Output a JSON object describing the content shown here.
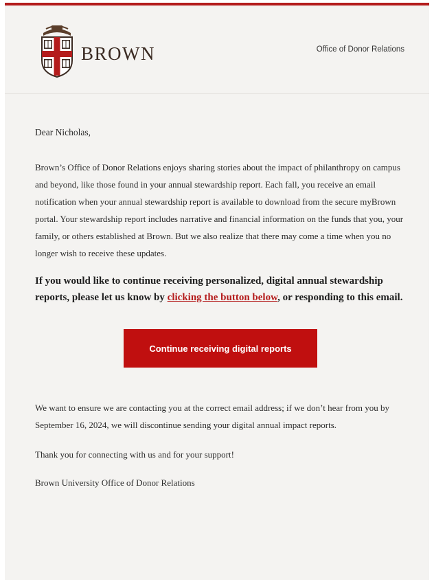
{
  "header": {
    "brand_name": "BROWN",
    "office_label": "Office of Donor Relations",
    "logo_icon": "brown-university-shield-icon",
    "accent_color": "#b41c1c"
  },
  "email": {
    "greeting": "Dear Nicholas,",
    "paragraph_1": "Brown’s Office of Donor Relations enjoys sharing stories about the impact of philanthropy on campus and beyond, like those found in your annual stewardship report. Each fall, you receive an email notification when your annual stewardship report is available to download from the secure myBrown portal. Your stewardship report includes narrative and financial information on the funds that you, your family, or others established at Brown. But we also realize that there may come a time when you no longer wish to receive these updates.",
    "bold_intro": "If you would like to continue receiving personalized, digital annual stewardship reports, please let us know by ",
    "bold_link": "clicking the button below",
    "bold_outro": ", or responding to this email.",
    "cta_label": "Continue receiving digital reports",
    "cta_color": "#c00f0f",
    "paragraph_2": "We want to ensure we are contacting you at the correct email address; if we don’t hear from you by September 16, 2024, we will discontinue sending your digital annual impact reports.",
    "paragraph_3": "Thank you for connecting with us and for your support!",
    "signature": "Brown University Office of Donor Relations"
  }
}
